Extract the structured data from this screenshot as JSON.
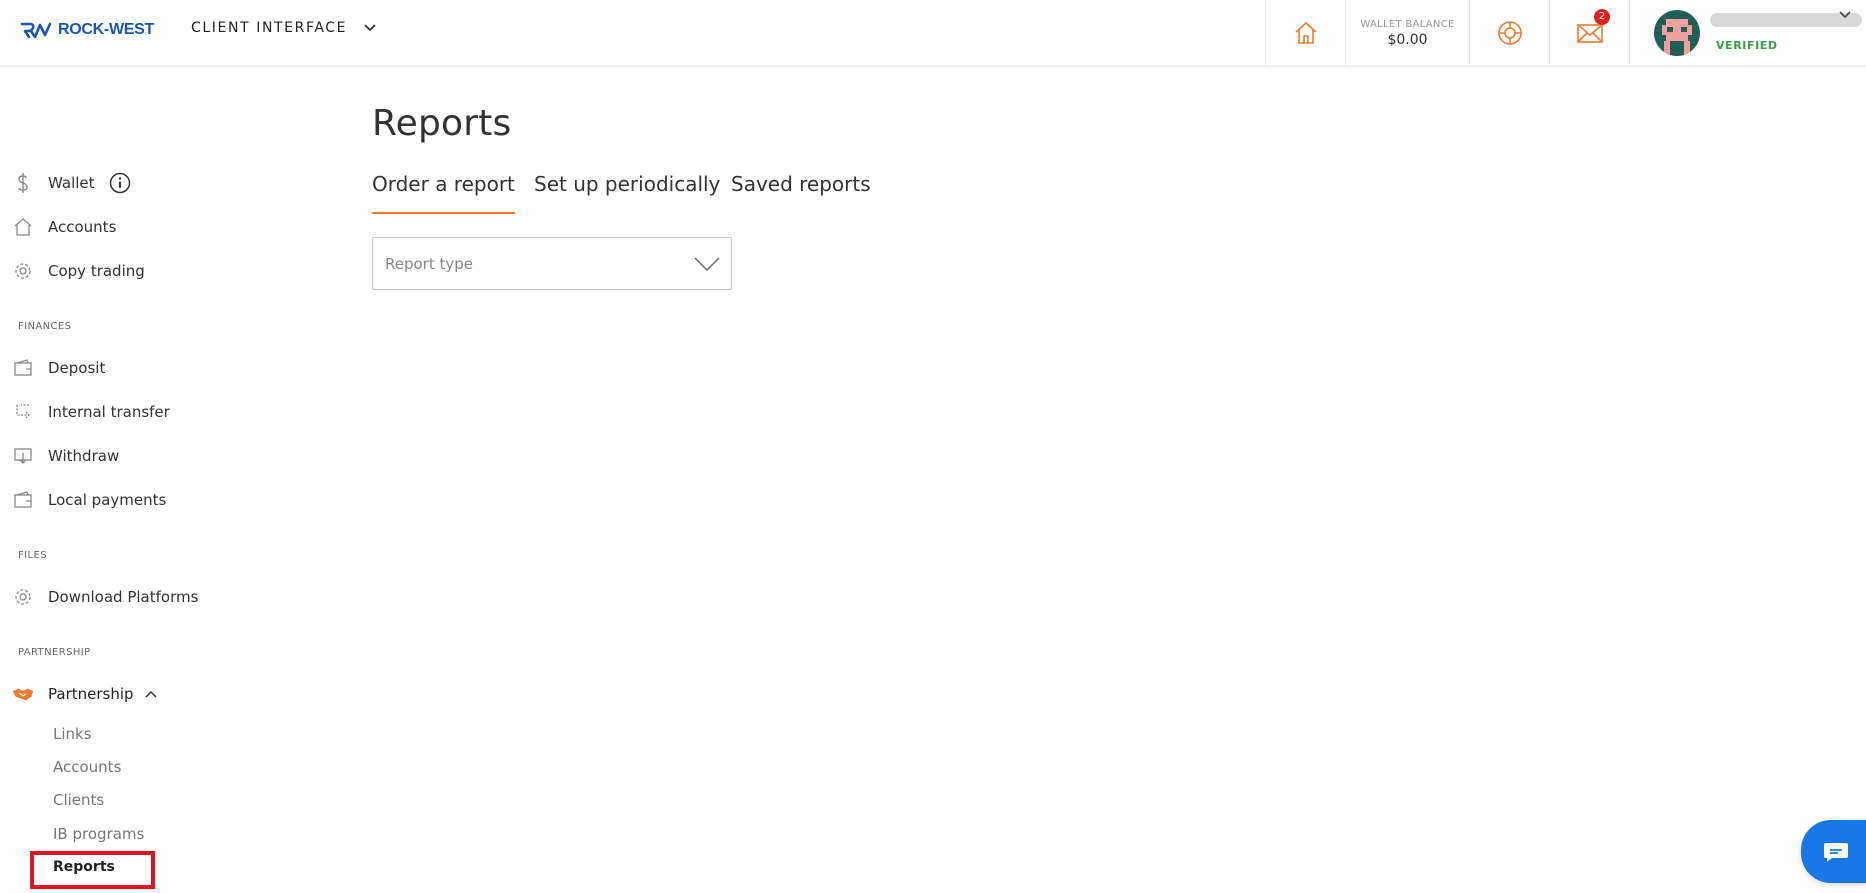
{
  "brand": {
    "name": "ROCK-WEST",
    "color": "#1a56b8"
  },
  "header": {
    "client_interface": "CLIENT INTERFACE",
    "wallet_balance_label": "WALLET BALANCE",
    "wallet_balance_value": "$0.00",
    "mail_badge": "2",
    "user_status": "VERIFIED",
    "icons": [
      "home-icon",
      "support-lifebuoy-icon",
      "mail-icon",
      "avatar"
    ]
  },
  "sidebar": {
    "items": [
      {
        "label": "Wallet",
        "icon": "dollar-icon"
      },
      {
        "label": "Accounts",
        "icon": "home-icon"
      },
      {
        "label": "Copy trading",
        "icon": "gear-icon"
      }
    ],
    "finances_heading": "FINANCES",
    "finances": [
      {
        "label": "Deposit",
        "icon": "wallet-icon"
      },
      {
        "label": "Internal transfer",
        "icon": "transfer-icon"
      },
      {
        "label": "Withdraw",
        "icon": "withdraw-icon"
      },
      {
        "label": "Local payments",
        "icon": "wallet-icon"
      }
    ],
    "files_heading": "FILES",
    "files": [
      {
        "label": "Download Platforms",
        "icon": "gear-icon"
      }
    ],
    "partnership_heading": "PARTNERSHIP",
    "partnership": {
      "label": "Partnership",
      "icon": "handshake-icon"
    },
    "partnership_sub": [
      "Links",
      "Accounts",
      "Clients",
      "IB programs",
      "Reports"
    ]
  },
  "main": {
    "title": "Reports",
    "tabs": [
      "Order a report",
      "Set up periodically",
      "Saved reports"
    ],
    "report_type_placeholder": "Report type"
  },
  "colors": {
    "accent_orange": "#f07a30",
    "chat_blue": "#1877e6",
    "highlight_red": "#e0141e",
    "verified_green": "#3aa045",
    "badge_red": "#e02020"
  }
}
